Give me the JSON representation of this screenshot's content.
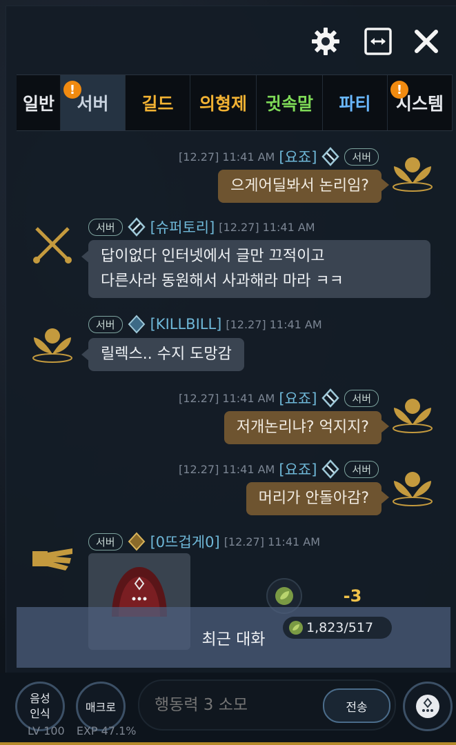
{
  "tabs": [
    {
      "label": "일반",
      "color": "#e6e8ec",
      "badge": ""
    },
    {
      "label": "서버",
      "color": "#c9d3df",
      "badge": "!",
      "active": true
    },
    {
      "label": "길드",
      "color": "#f2b233",
      "badge": ""
    },
    {
      "label": "의형제",
      "color": "#f2b233",
      "badge": ""
    },
    {
      "label": "귓속말",
      "color": "#7ed957",
      "badge": ""
    },
    {
      "label": "파티",
      "color": "#6ab8ff",
      "badge": ""
    },
    {
      "label": "시스템",
      "color": "#e6e8ec",
      "badge": "!"
    }
  ],
  "messages": [
    {
      "time": "[12.27] 11:41 AM",
      "name": "[요죠]",
      "chip": "서버",
      "text": "으게어딜봐서 논리임?"
    },
    {
      "time": "[12.27] 11:41 AM",
      "name": "[슈퍼토리]",
      "chip": "서버",
      "text1": "답이없다 인터넷에서 글만 끄적이고",
      "text2": "다른사라 동원해서 사과해라 마라 ㅋㅋ"
    },
    {
      "time": "[12.27] 11:41 AM",
      "name": "[KILLBILL]",
      "chip": "서버",
      "text": "릴렉스.. 수지 도망감"
    },
    {
      "time": "[12.27] 11:41 AM",
      "name": "[요죠]",
      "chip": "서버",
      "text": "저개논리냐? 억지지?"
    },
    {
      "time": "[12.27] 11:41 AM",
      "name": "[요죠]",
      "chip": "서버",
      "text": "머리가 안돌아감?"
    },
    {
      "time": "[12.27] 11:41 AM",
      "name": "[0뜨겁게0]",
      "chip": "서버"
    }
  ],
  "popup": {
    "delta": "-3",
    "currency": "1,823/517"
  },
  "recent_label": "최근 대화",
  "bottom": {
    "voice_line1": "음성",
    "voice_line2": "인식",
    "macro": "매크로",
    "input_placeholder": "행동력 3 소모",
    "send": "전송",
    "level": "LV 100",
    "exp": "EXP 47.1%"
  },
  "colors": {
    "accent_gold": "#b58a2a",
    "bubble_me": "#6e5430",
    "bubble_other": "#3a4451",
    "name": "#6fb8d8"
  }
}
